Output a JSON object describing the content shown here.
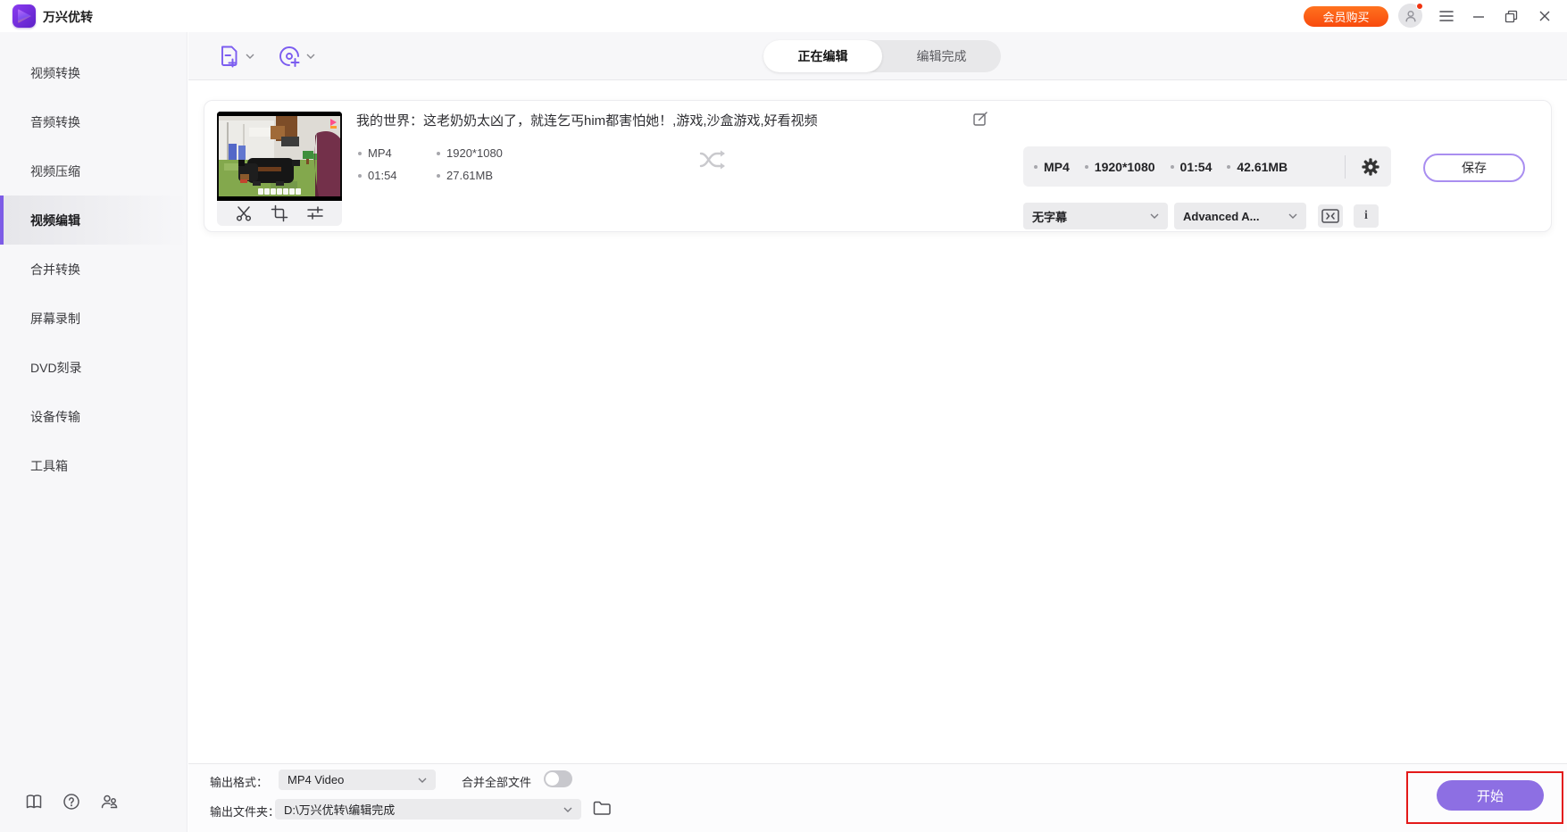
{
  "app": {
    "name": "万兴优转"
  },
  "titlebar": {
    "buy_label": "会员购买"
  },
  "sidebar": {
    "items": [
      {
        "label": "视频转换"
      },
      {
        "label": "音频转换"
      },
      {
        "label": "视频压缩"
      },
      {
        "label": "视频编辑"
      },
      {
        "label": "合并转换"
      },
      {
        "label": "屏幕录制"
      },
      {
        "label": "DVD刻录"
      },
      {
        "label": "设备传输"
      },
      {
        "label": "工具箱"
      }
    ]
  },
  "tabs": {
    "editing": "正在编辑",
    "done": "编辑完成"
  },
  "item": {
    "title": "我的世界：这老奶奶太凶了，就连乞丐him都害怕她！,游戏,沙盒游戏,好看视频",
    "source": {
      "format": "MP4",
      "resolution": "1920*1080",
      "duration": "01:54",
      "size": "27.61MB"
    },
    "output": {
      "format": "MP4",
      "resolution": "1920*1080",
      "duration": "01:54",
      "size": "42.61MB"
    },
    "subtitle_value": "无字幕",
    "audio_value": "Advanced A...",
    "info_glyph": "i",
    "save_label": "保存"
  },
  "bottombar": {
    "format_label": "输出格式：",
    "format_value": "MP4 Video",
    "merge_label": "合并全部文件",
    "merge_on": false,
    "folder_label": "输出文件夹：",
    "folder_value": "D:\\万兴优转\\编辑完成",
    "start_label": "开始"
  },
  "colors": {
    "accent_purple": "#7d5ce6",
    "start_button_purple": "#8d6fe3",
    "brand_orange": "#f84a0d",
    "highlight_red": "#e31919"
  }
}
